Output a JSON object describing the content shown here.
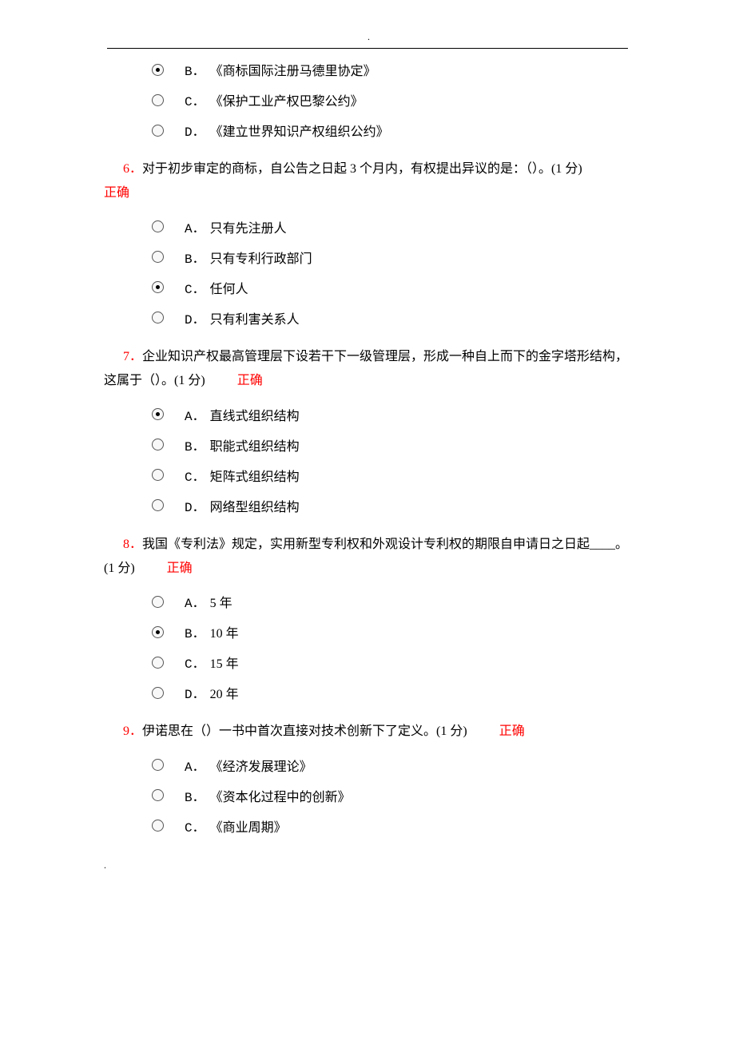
{
  "top_options": [
    {
      "letter": "B．",
      "text": "《商标国际注册马德里协定》",
      "selected": true
    },
    {
      "letter": "C．",
      "text": "《保护工业产权巴黎公约》",
      "selected": false
    },
    {
      "letter": "D．",
      "text": "《建立世界知识产权组织公约》",
      "selected": false
    }
  ],
  "questions": [
    {
      "num": "6．",
      "text": "对于初步审定的商标，自公告之日起 3 个月内，有权提出异议的是：（）。",
      "score": "(1 分)",
      "correct": "正确",
      "correct_inline": false,
      "options": [
        {
          "letter": "A．",
          "text": "只有先注册人",
          "selected": false
        },
        {
          "letter": "B．",
          "text": "只有专利行政部门",
          "selected": false
        },
        {
          "letter": "C．",
          "text": "任何人",
          "selected": true
        },
        {
          "letter": "D．",
          "text": "只有利害关系人",
          "selected": false
        }
      ]
    },
    {
      "num": "7．",
      "text": "企业知识产权最高管理层下设若干下一级管理层，形成一种自上而下的金字塔形结构，这属于（）。",
      "score": "(1 分)",
      "correct": "正确",
      "correct_inline": true,
      "options": [
        {
          "letter": "A．",
          "text": "直线式组织结构",
          "selected": true
        },
        {
          "letter": "B．",
          "text": "职能式组织结构",
          "selected": false
        },
        {
          "letter": "C．",
          "text": "矩阵式组织结构",
          "selected": false
        },
        {
          "letter": "D．",
          "text": "网络型组织结构",
          "selected": false
        }
      ]
    },
    {
      "num": "8．",
      "text": "我国《专利法》规定，实用新型专利权和外观设计专利权的期限自申请日之日起____。",
      "score": "(1 分)",
      "correct": "正确",
      "correct_inline": true,
      "score_newline": true,
      "options": [
        {
          "letter": "A．",
          "text": "5 年",
          "selected": false
        },
        {
          "letter": "B．",
          "text": "10 年",
          "selected": true
        },
        {
          "letter": "C．",
          "text": "15 年",
          "selected": false
        },
        {
          "letter": "D．",
          "text": "20 年",
          "selected": false
        }
      ]
    },
    {
      "num": "9．",
      "text": "伊诺思在（）一书中首次直接对技术创新下了定义。",
      "score": "(1 分)",
      "correct": "正确",
      "correct_inline": true,
      "options": [
        {
          "letter": "A．",
          "text": "《经济发展理论》",
          "selected": false
        },
        {
          "letter": "B．",
          "text": "《资本化过程中的创新》",
          "selected": false
        },
        {
          "letter": "C．",
          "text": "《商业周期》",
          "selected": false
        }
      ]
    }
  ]
}
